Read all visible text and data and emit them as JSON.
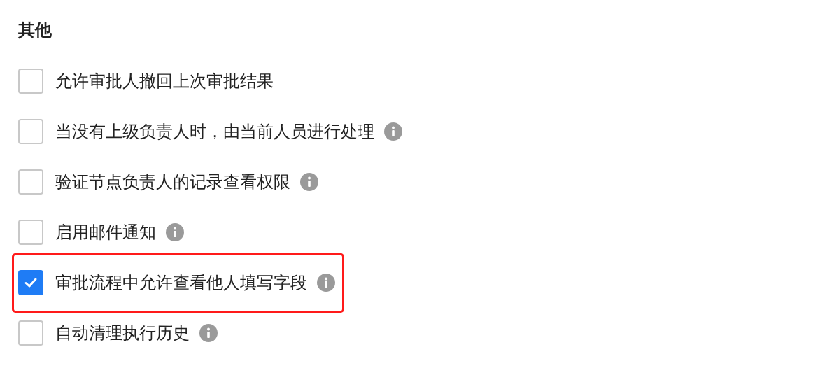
{
  "section": {
    "title": "其他"
  },
  "options": [
    {
      "label": "允许审批人撤回上次审批结果",
      "checked": false,
      "info": false,
      "highlighted": false
    },
    {
      "label": "当没有上级负责人时，由当前人员进行处理",
      "checked": false,
      "info": true,
      "highlighted": false
    },
    {
      "label": "验证节点负责人的记录查看权限",
      "checked": false,
      "info": true,
      "highlighted": false
    },
    {
      "label": "启用邮件通知",
      "checked": false,
      "info": true,
      "highlighted": false
    },
    {
      "label": "审批流程中允许查看他人填写字段",
      "checked": true,
      "info": true,
      "highlighted": true
    },
    {
      "label": "自动清理执行历史",
      "checked": false,
      "info": true,
      "highlighted": false
    }
  ]
}
